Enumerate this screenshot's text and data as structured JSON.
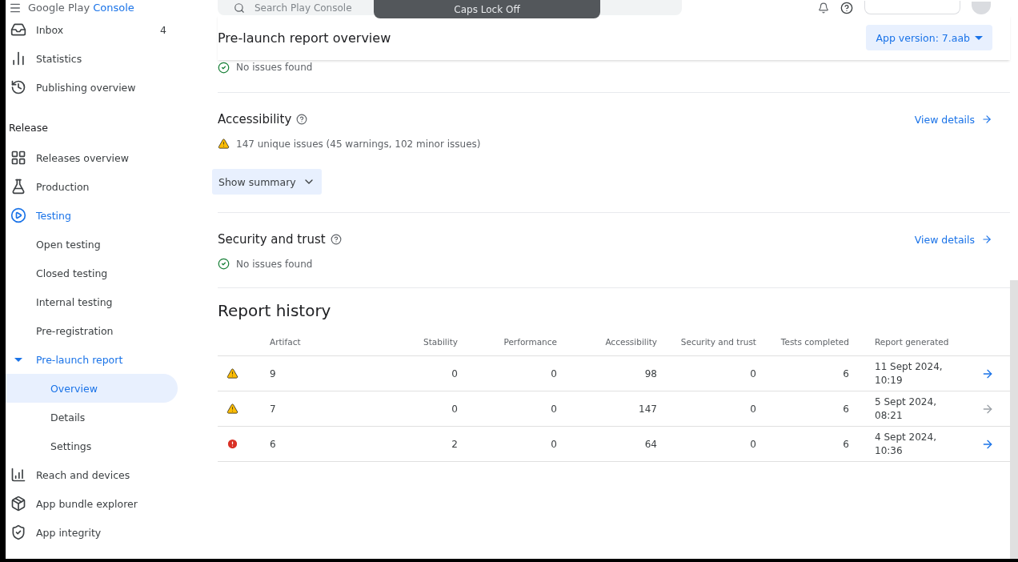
{
  "brand": {
    "name": "Google Play",
    "product": "Console"
  },
  "search": {
    "placeholder": "Search Play Console"
  },
  "toast": {
    "text": "Caps Lock Off"
  },
  "sidebar": {
    "top_items": [
      {
        "label": "Inbox",
        "badge": "4"
      },
      {
        "label": "Statistics"
      },
      {
        "label": "Publishing overview"
      }
    ],
    "sections": [
      {
        "title": "Release",
        "items": [
          {
            "label": "Releases overview",
            "selected": false,
            "highlighted": false
          },
          {
            "label": "Production",
            "selected": false,
            "highlighted": false
          },
          {
            "label": "Testing",
            "selected": false,
            "highlighted": true,
            "children": [
              {
                "label": "Open testing",
                "selected": false,
                "highlighted": false
              },
              {
                "label": "Closed testing",
                "selected": false,
                "highlighted": false
              },
              {
                "label": "Internal testing",
                "selected": false,
                "highlighted": false
              },
              {
                "label": "Pre-registration",
                "selected": false,
                "highlighted": false
              },
              {
                "label": "Pre-launch report",
                "selected": false,
                "highlighted": true,
                "expanded": true,
                "children": [
                  {
                    "label": "Overview",
                    "selected": true,
                    "highlighted": true
                  },
                  {
                    "label": "Details",
                    "selected": false,
                    "highlighted": false
                  },
                  {
                    "label": "Settings",
                    "selected": false,
                    "highlighted": false
                  }
                ]
              }
            ]
          },
          {
            "label": "Reach and devices",
            "selected": false,
            "highlighted": false
          },
          {
            "label": "App bundle explorer",
            "selected": false,
            "highlighted": false
          },
          {
            "label": "App integrity",
            "selected": false,
            "highlighted": false
          }
        ]
      }
    ]
  },
  "header": {
    "title": "Pre-launch report overview",
    "version_button": "App version: 7.aab",
    "status": "No issues found"
  },
  "sections": [
    {
      "title": "Accessibility",
      "kind": "warning",
      "status": "147 unique issues (45 warnings, 102 minor issues)",
      "link": "View details",
      "summary_button": "Show summary"
    },
    {
      "title": "Security and trust",
      "kind": "ok",
      "status": "No issues found",
      "link": "View details"
    }
  ],
  "report_history": {
    "title": "Report history",
    "columns": [
      "Artifact",
      "Stability",
      "Performance",
      "Accessibility",
      "Security and trust",
      "Tests completed",
      "Report generated"
    ],
    "rows": [
      {
        "kind": "warning",
        "cells": [
          "9",
          "0",
          "0",
          "98",
          "0",
          "6",
          "11 Sept 2024, 10:19"
        ],
        "disabled": false
      },
      {
        "kind": "warning",
        "cells": [
          "7",
          "0",
          "0",
          "147",
          "0",
          "6",
          "5 Sept 2024, 08:21"
        ],
        "disabled": true
      },
      {
        "kind": "error",
        "cells": [
          "6",
          "2",
          "0",
          "64",
          "0",
          "6",
          "4 Sept 2024, 10:36"
        ],
        "disabled": false
      }
    ]
  }
}
